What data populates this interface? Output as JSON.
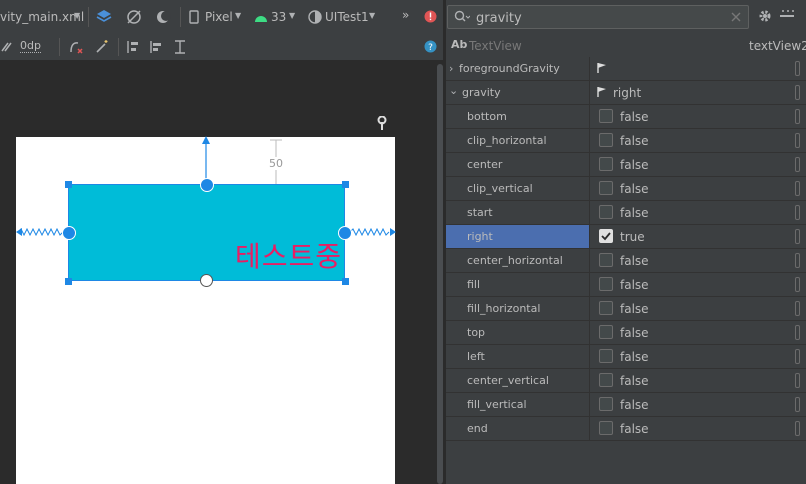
{
  "toolbar": {
    "file_tab": "vity_main.xml",
    "device": "Pixel",
    "api_level": "33",
    "theme": "UITest1",
    "margin_value": "0dp",
    "overflow": "»"
  },
  "canvas": {
    "text_content": "테스트중",
    "margin_label": "50"
  },
  "panel": {
    "search_value": "gravity",
    "component_type_icon": "Ab",
    "component_type": "TextView",
    "component_id": "textView2",
    "foreground_gravity_label": "foregroundGravity",
    "gravity_label": "gravity",
    "gravity_value": "right",
    "flags": [
      {
        "name": "bottom",
        "value": "false",
        "checked": false
      },
      {
        "name": "clip_horizontal",
        "value": "false",
        "checked": false
      },
      {
        "name": "center",
        "value": "false",
        "checked": false
      },
      {
        "name": "clip_vertical",
        "value": "false",
        "checked": false
      },
      {
        "name": "start",
        "value": "false",
        "checked": false
      },
      {
        "name": "right",
        "value": "true",
        "checked": true
      },
      {
        "name": "center_horizontal",
        "value": "false",
        "checked": false
      },
      {
        "name": "fill",
        "value": "false",
        "checked": false
      },
      {
        "name": "fill_horizontal",
        "value": "false",
        "checked": false
      },
      {
        "name": "top",
        "value": "false",
        "checked": false
      },
      {
        "name": "left",
        "value": "false",
        "checked": false
      },
      {
        "name": "center_vertical",
        "value": "false",
        "checked": false
      },
      {
        "name": "fill_vertical",
        "value": "false",
        "checked": false
      },
      {
        "name": "end",
        "value": "false",
        "checked": false
      }
    ]
  },
  "colors": {
    "selected_row": "#4b6eaf",
    "textview_bg": "#00bcd8",
    "text_pink": "#e91e63",
    "accent_blue": "#1e88e5"
  }
}
